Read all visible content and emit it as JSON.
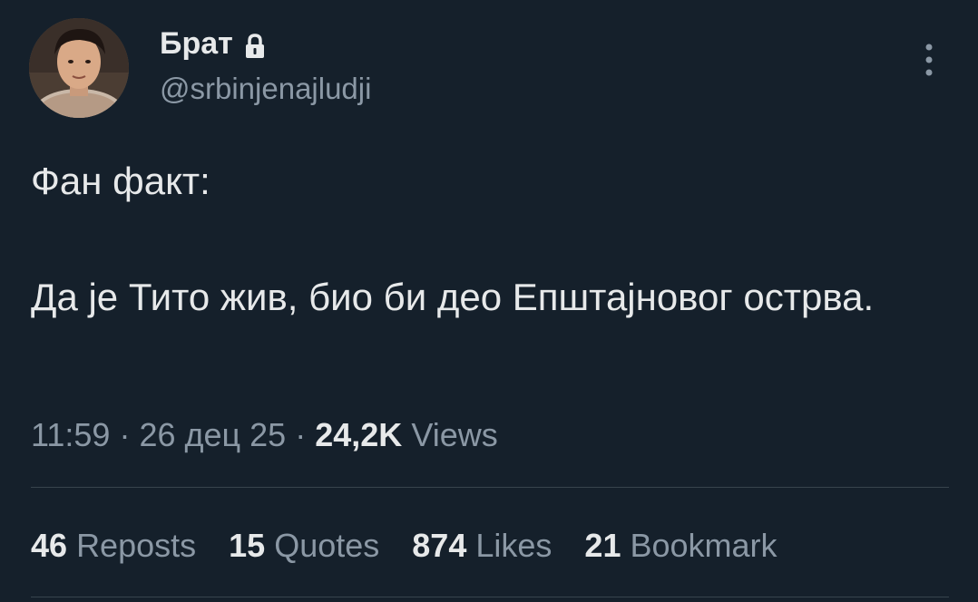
{
  "user": {
    "display_name": "Брат",
    "handle": "@srbinjenajludji",
    "protected_icon": "lock-icon"
  },
  "tweet": {
    "line1": "Фан факт:",
    "line2": "Да је Тито жив, био би део Епштајновог острва."
  },
  "meta": {
    "time": "11:59",
    "sep1": "·",
    "date": "26 дец 25",
    "sep2": "·",
    "views_count": "24,2K",
    "views_label": "Views"
  },
  "stats": [
    {
      "count": "46",
      "label": "Reposts"
    },
    {
      "count": "15",
      "label": "Quotes"
    },
    {
      "count": "874",
      "label": "Likes"
    },
    {
      "count": "21",
      "label": "Bookmark"
    }
  ],
  "colors": {
    "background": "#15202b",
    "text": "#e7e9ea",
    "secondary": "#8b98a5",
    "divider": "#38444d"
  }
}
